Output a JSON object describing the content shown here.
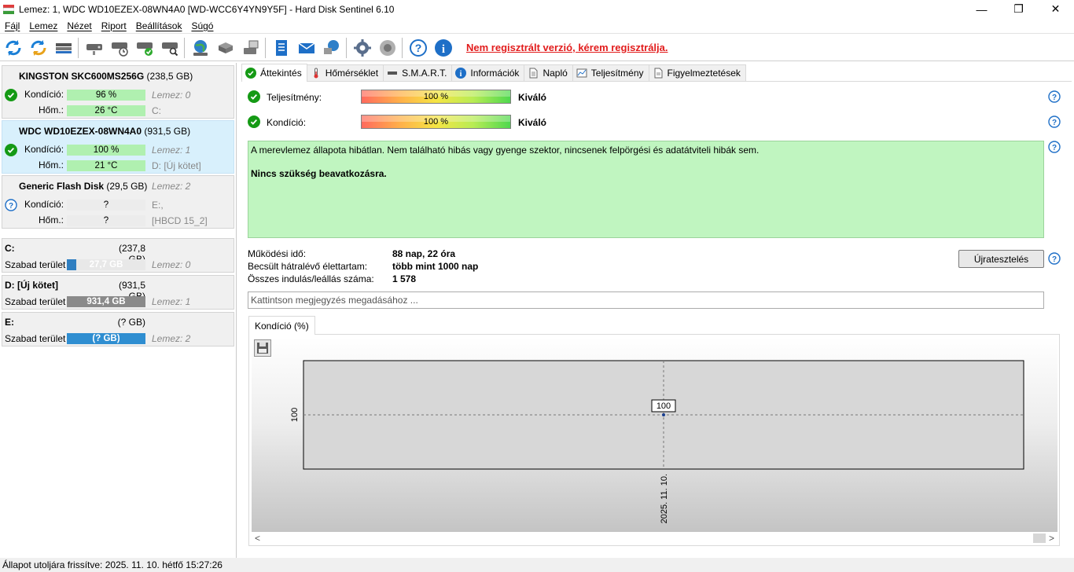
{
  "window": {
    "title": "Lemez: 1, WDC WD10EZEX-08WN4A0 [WD-WCC6Y4YN9Y5F]  -  Hard Disk Sentinel 6.10",
    "minimize": "—",
    "maximize": "❐",
    "close": "✕"
  },
  "menu": [
    "Fájl",
    "Lemez",
    "Nézet",
    "Riport",
    "Beállítások",
    "Súgó"
  ],
  "toolbar": {
    "register_link": "Nem regisztrált verzió, kérem regisztrálja.",
    "icons": [
      "refresh-icon",
      "refresh-all-icon",
      "drive-icon",
      "disk-test-icon",
      "disk-schedule-icon",
      "disk-ok-icon",
      "disk-search-icon",
      "web-icon",
      "server-icon",
      "network-drive-icon",
      "report-icon",
      "email-icon",
      "send-icon",
      "settings-icon",
      "sound-icon",
      "help-icon",
      "info-icon"
    ]
  },
  "disks": [
    {
      "name": "KINGSTON SKC600MS256G",
      "size": "(238,5 GB)",
      "cond_label": "Kondíció:",
      "cond": "96 %",
      "cond_ghost": "Lemez: 0",
      "temp_label": "Hőm.:",
      "temp": "26 °C",
      "temp_ghost": "C:"
    },
    {
      "name": "WDC WD10EZEX-08WN4A0",
      "size": "(931,5 GB)",
      "cond_label": "Kondíció:",
      "cond": "100 %",
      "cond_ghost": "Lemez: 1",
      "temp_label": "Hőm.:",
      "temp": "21 °C",
      "temp_ghost": "D: [Új kötet]"
    },
    {
      "name": "Generic Flash Disk",
      "size": "(29,5 GB)",
      "size_ghost": "Lemez: 2",
      "cond_label": "Kondíció:",
      "cond": "?",
      "cond_ghost": "E:,",
      "temp_label": "Hőm.:",
      "temp": "?",
      "temp_ghost": "[HBCD 15_2]"
    }
  ],
  "volumes": [
    {
      "name": "C:",
      "size": "(237,8 GB)",
      "free_label": "Szabad terület",
      "free": "27,7 GB",
      "ghost": "Lemez: 0",
      "bar_color": "#2f7fc1",
      "fill": 0.12
    },
    {
      "name": "D: [Új kötet]",
      "size": "(931,5 GB)",
      "free_label": "Szabad terület",
      "free": "931,4 GB",
      "ghost": "Lemez: 1",
      "bar_color": "#8a8a8a",
      "fill": 1.0
    },
    {
      "name": "E:",
      "size": "(? GB)",
      "free_label": "Szabad terület",
      "free": "(? GB)",
      "ghost": "Lemez: 2",
      "bar_color": "#2f8ed1",
      "fill": 1.0
    }
  ],
  "tabs": [
    "Áttekintés",
    "Hőmérséklet",
    "S.M.A.R.T.",
    "Információk",
    "Napló",
    "Teljesítmény",
    "Figyelmeztetések"
  ],
  "overview": {
    "performance": {
      "label": "Teljesítmény:",
      "value": "100 %",
      "result": "Kiváló"
    },
    "condition": {
      "label": "Kondíció:",
      "value": "100 %",
      "result": "Kiváló"
    },
    "status_line1": "A merevlemez állapota hibátlan. Nem található hibás vagy gyenge szektor, nincsenek felpörgési és adatátviteli hibák sem.",
    "status_line2": "Nincs szükség beavatkozásra.",
    "stats": [
      {
        "label": "Működési idő:",
        "value": "88 nap, 22 óra"
      },
      {
        "label": "Becsült hátralévő élettartam:",
        "value": "több mint 1000 nap"
      },
      {
        "label": "Összes indulás/leállás száma:",
        "value": "1 578"
      }
    ],
    "retest_button": "Újratesztelés",
    "note_placeholder": "Kattintson megjegyzés megadásához ...",
    "chart_tab": "Kondíció  (%)",
    "scroll_left": "<",
    "scroll_right": ">"
  },
  "chart_data": {
    "type": "line",
    "x": [
      "2025. 11. 10."
    ],
    "series": [
      {
        "values": [
          100
        ]
      }
    ],
    "ytick": "100",
    "data_label": "100"
  },
  "statusbar": "Állapot utoljára frissítve: 2025. 11. 10. hétfő 15:27:26"
}
